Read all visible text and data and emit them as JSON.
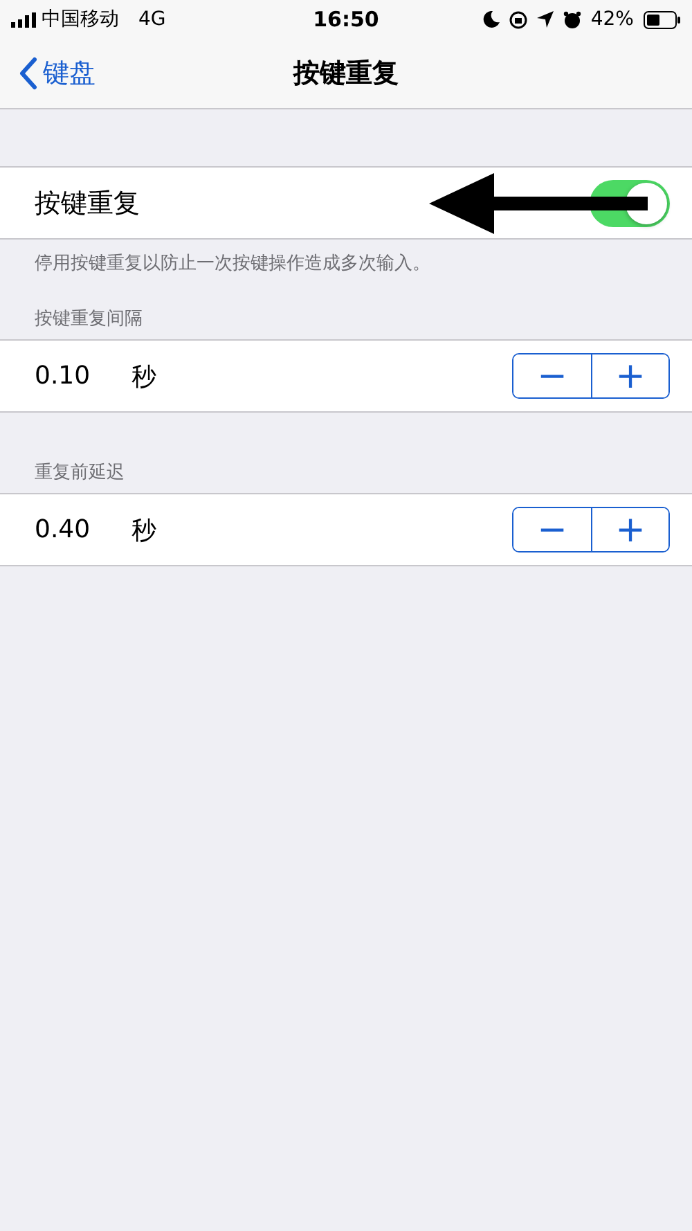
{
  "status_bar": {
    "carrier": "中国移动",
    "network": "4G",
    "time": "16:50",
    "battery": "42%"
  },
  "nav": {
    "back": "键盘",
    "title": "按键重复"
  },
  "toggle_row": {
    "label": "按键重复",
    "on": true,
    "footer": "停用按键重复以防止一次按键操作造成多次输入。"
  },
  "sections": [
    {
      "header": "按键重复间隔",
      "value": "0.10",
      "unit": "秒",
      "minus": "−",
      "plus": "+"
    },
    {
      "header": "重复前延迟",
      "value": "0.40",
      "unit": "秒",
      "minus": "−",
      "plus": "+"
    }
  ]
}
